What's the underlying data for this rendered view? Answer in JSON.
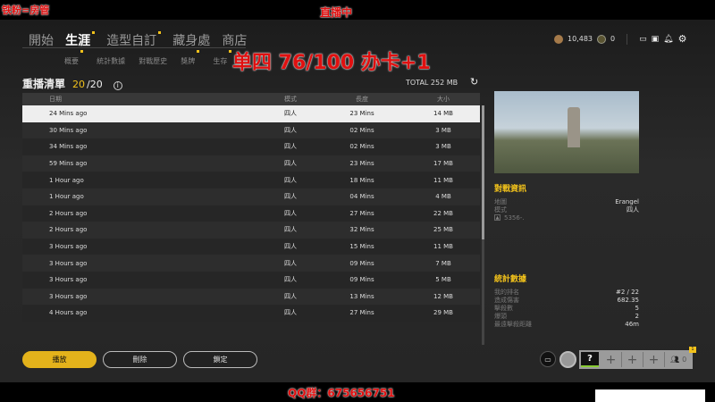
{
  "overlay": {
    "top_left": "铁粉=房管",
    "live": "直播中",
    "banner": "单四  76/100 办卡+1",
    "qq": "QQ群：675656751"
  },
  "nav": {
    "tabs": [
      "開始",
      "生涯",
      "造型自訂",
      "藏身處",
      "商店"
    ],
    "subtabs": [
      "概要",
      "統計數據",
      "對戰歷史",
      "獎牌",
      "生存"
    ]
  },
  "currency": {
    "bp": "10,483",
    "g": "0"
  },
  "replay": {
    "title": "重播清單",
    "count": "20",
    "total": "/20",
    "total_size": "TOTAL 252 MB",
    "headers": [
      "日期",
      "模式",
      "長度",
      "大小"
    ],
    "rows": [
      [
        "24 Mins ago",
        "四人",
        "23 Mins",
        "14 MB"
      ],
      [
        "30 Mins ago",
        "四人",
        "02 Mins",
        "3 MB"
      ],
      [
        "34 Mins ago",
        "四人",
        "02 Mins",
        "3 MB"
      ],
      [
        "59 Mins ago",
        "四人",
        "23 Mins",
        "17 MB"
      ],
      [
        "1 Hour ago",
        "四人",
        "18 Mins",
        "11 MB"
      ],
      [
        "1 Hour ago",
        "四人",
        "04 Mins",
        "4 MB"
      ],
      [
        "2 Hours ago",
        "四人",
        "27 Mins",
        "22 MB"
      ],
      [
        "2 Hours ago",
        "四人",
        "32 Mins",
        "25 MB"
      ],
      [
        "3 Hours ago",
        "四人",
        "15 Mins",
        "11 MB"
      ],
      [
        "3 Hours ago",
        "四人",
        "09 Mins",
        "7 MB"
      ],
      [
        "3 Hours ago",
        "四人",
        "09 Mins",
        "5 MB"
      ],
      [
        "3 Hours ago",
        "四人",
        "13 Mins",
        "12 MB"
      ],
      [
        "4 Hours ago",
        "四人",
        "27 Mins",
        "29 MB"
      ]
    ]
  },
  "match": {
    "title": "對戰資訊",
    "map_label": "地圖",
    "map": "Erangel",
    "mode_label": "模式",
    "mode": "四人",
    "player": "5356-."
  },
  "stats": {
    "title": "統計數據",
    "items": [
      [
        "我的排名",
        "#2 / 22"
      ],
      [
        "造成傷害",
        "682.35"
      ],
      [
        "擊殺數",
        "5"
      ],
      [
        "爆頭",
        "2"
      ],
      [
        "最遠擊殺距離",
        "46m"
      ]
    ]
  },
  "buttons": {
    "play": "播放",
    "delete": "刪除",
    "lock": "鎖定"
  },
  "squad": {
    "slot1": "?",
    "plus": "+",
    "count": "0",
    "badge": "1"
  }
}
